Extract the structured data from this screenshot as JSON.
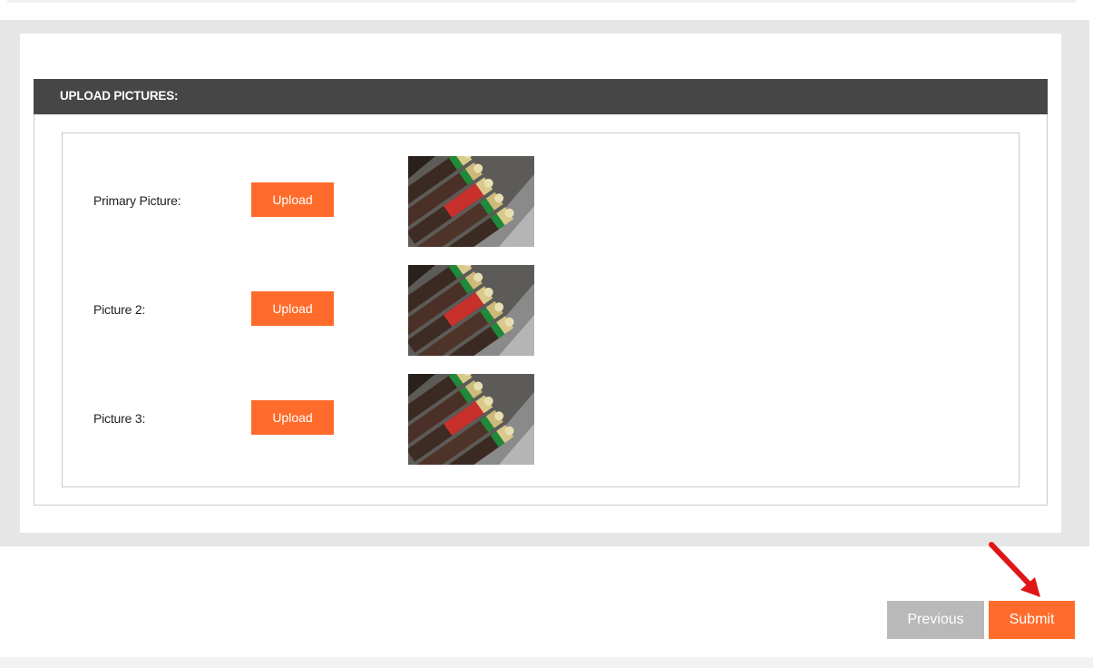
{
  "section": {
    "title": "UPLOAD PICTURES:"
  },
  "pictures": [
    {
      "label": "Primary Picture:",
      "button": "Upload",
      "image": "shotgun-shells-photo"
    },
    {
      "label": "Picture 2:",
      "button": "Upload",
      "image": "shotgun-shells-photo"
    },
    {
      "label": "Picture 3:",
      "button": "Upload",
      "image": "shotgun-shells-photo"
    }
  ],
  "footer": {
    "previous_label": "Previous",
    "submit_label": "Submit"
  },
  "annotation": {
    "icon": "red-arrow-icon",
    "color": "#e01616"
  },
  "colors": {
    "accent": "#ff6b2b",
    "header_bg": "#464646",
    "secondary_button": "#b9b9b9"
  }
}
